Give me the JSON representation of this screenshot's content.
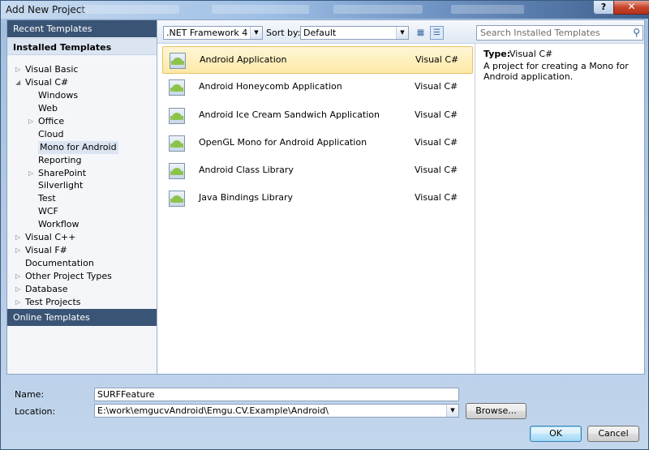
{
  "window": {
    "title": "Add New Project",
    "help_label": "?",
    "close_label": "✕"
  },
  "left": {
    "recent_templates": "Recent Templates",
    "installed_templates": "Installed Templates",
    "online_templates": "Online Templates",
    "tree": [
      {
        "label": "Visual Basic",
        "level": 1,
        "expander": "collapsed"
      },
      {
        "label": "Visual C#",
        "level": 1,
        "expander": "expanded"
      },
      {
        "label": "Windows",
        "level": 2,
        "expander": "none"
      },
      {
        "label": "Web",
        "level": 2,
        "expander": "none"
      },
      {
        "label": "Office",
        "level": 2,
        "expander": "collapsed"
      },
      {
        "label": "Cloud",
        "level": 2,
        "expander": "none"
      },
      {
        "label": "Mono for Android",
        "level": 2,
        "expander": "none",
        "selected": true
      },
      {
        "label": "Reporting",
        "level": 2,
        "expander": "none"
      },
      {
        "label": "SharePoint",
        "level": 2,
        "expander": "collapsed"
      },
      {
        "label": "Silverlight",
        "level": 2,
        "expander": "none"
      },
      {
        "label": "Test",
        "level": 2,
        "expander": "none"
      },
      {
        "label": "WCF",
        "level": 2,
        "expander": "none"
      },
      {
        "label": "Workflow",
        "level": 2,
        "expander": "none"
      },
      {
        "label": "Visual C++",
        "level": 1,
        "expander": "collapsed"
      },
      {
        "label": "Visual F#",
        "level": 1,
        "expander": "collapsed"
      },
      {
        "label": "Documentation",
        "level": 1,
        "expander": "none"
      },
      {
        "label": "Other Project Types",
        "level": 1,
        "expander": "collapsed"
      },
      {
        "label": "Database",
        "level": 1,
        "expander": "collapsed"
      },
      {
        "label": "Test Projects",
        "level": 1,
        "expander": "collapsed"
      }
    ]
  },
  "toolbar": {
    "framework": ".NET Framework 4",
    "sort_label": "Sort by:",
    "sort_value": "Default",
    "search_placeholder": "Search Installed Templates"
  },
  "templates": [
    {
      "name": "Android Application",
      "lang": "Visual C#",
      "selected": true
    },
    {
      "name": "Android Honeycomb Application",
      "lang": "Visual C#"
    },
    {
      "name": "Android Ice Cream Sandwich Application",
      "lang": "Visual C#"
    },
    {
      "name": "OpenGL Mono for Android Application",
      "lang": "Visual C#"
    },
    {
      "name": "Android Class Library",
      "lang": "Visual C#"
    },
    {
      "name": "Java Bindings Library",
      "lang": "Visual C#"
    }
  ],
  "details": {
    "type_label": "Type:",
    "type_value": "Visual C#",
    "description": "A project for creating a Mono for Android application."
  },
  "form": {
    "name_label": "Name:",
    "name_value": "SURFFeature",
    "location_label": "Location:",
    "location_value": "E:\\work\\emgucvAndroid\\Emgu.CV.Example\\Android\\",
    "browse_label": "Browse...",
    "ok_label": "OK",
    "cancel_label": "Cancel"
  }
}
